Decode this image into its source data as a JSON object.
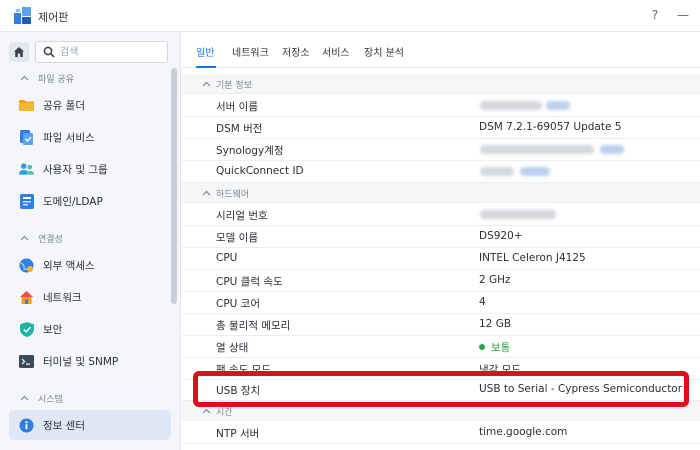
{
  "window": {
    "title": "제어판",
    "help_label": "?",
    "minimize_label": "—"
  },
  "sidebar": {
    "search_placeholder": "검색",
    "sections": [
      {
        "label": "파일 공유"
      },
      {
        "label": "연결성"
      },
      {
        "label": "시스템"
      }
    ],
    "items": [
      {
        "label": "공유 폴더",
        "icon": "folder-icon"
      },
      {
        "label": "파일 서비스",
        "icon": "file-services-icon"
      },
      {
        "label": "사용자 및 그룹",
        "icon": "users-icon"
      },
      {
        "label": "도메인/LDAP",
        "icon": "domain-icon"
      },
      {
        "label": "외부 액세스",
        "icon": "globe-icon"
      },
      {
        "label": "네트워크",
        "icon": "house-network-icon"
      },
      {
        "label": "보안",
        "icon": "shield-icon"
      },
      {
        "label": "터미널 및 SNMP",
        "icon": "terminal-icon"
      },
      {
        "label": "정보 센터",
        "icon": "info-icon"
      }
    ]
  },
  "tabs": [
    {
      "label": "일반",
      "active": true
    },
    {
      "label": "네트워크"
    },
    {
      "label": "저장소"
    },
    {
      "label": "서비스"
    },
    {
      "label": "장치 분석"
    }
  ],
  "info": {
    "group_basic": "기본 정보",
    "server_name": "서버 이름",
    "dsm_version_label": "DSM 버전",
    "dsm_version": "DSM 7.2.1-69057 Update 5",
    "synology_account": "Synology계정",
    "quickconnect": "QuickConnect ID",
    "group_hardware": "하드웨어",
    "serial_label": "시리얼 번호",
    "model_label": "모델 이름",
    "model": "DS920+",
    "cpu_label": "CPU",
    "cpu": "INTEL Celeron J4125",
    "cpu_clock_label": "CPU 클럭 속도",
    "cpu_clock": "2 GHz",
    "cpu_cores_label": "CPU 코어",
    "cpu_cores": "4",
    "memory_label": "총 물리적 메모리",
    "memory": "12 GB",
    "thermal_label": "열 상태",
    "thermal": "보통",
    "fan_label": "팬 속도 모드",
    "fan": "냉각 모드",
    "usb_label": "USB 장치",
    "usb": "USB to Serial - Cypress Semiconductor",
    "group_time": "시간",
    "ntp_label": "NTP 서버",
    "ntp": "time.google.com"
  },
  "colors": {
    "accent": "#1677d8",
    "status_ok": "#26a544",
    "highlight": "#e00d1d"
  }
}
